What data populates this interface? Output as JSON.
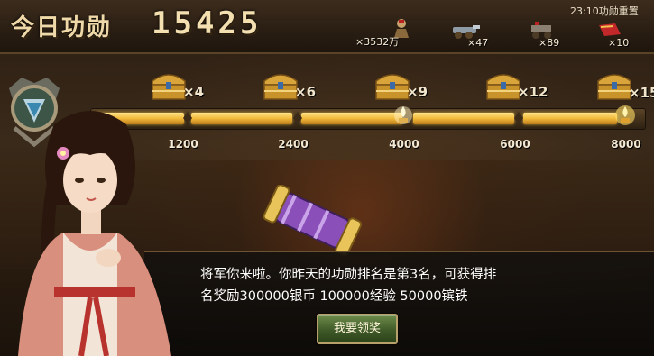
{
  "header": {
    "title": "今日功勋",
    "score": "15425",
    "reset_info": "23:10功勋重置"
  },
  "resources": [
    {
      "icon": "soldier-icon",
      "count": "×3532万"
    },
    {
      "icon": "cannon-icon",
      "count": "×47"
    },
    {
      "icon": "chariot-icon",
      "count": "×89"
    },
    {
      "icon": "red-gift-icon",
      "count": "×10"
    }
  ],
  "milestones": [
    {
      "chest_count": "×4",
      "value": "1200"
    },
    {
      "chest_count": "×6",
      "value": "2400"
    },
    {
      "chest_count": "×9",
      "value": "4000"
    },
    {
      "chest_count": "×12",
      "value": "6000"
    },
    {
      "chest_count": "×15",
      "value": "8000"
    }
  ],
  "progress": {
    "current": 15425,
    "max": 8000,
    "fraction": 1.0
  },
  "dialog": {
    "line1": "将军你来啦。你昨天的功勋排名是第3名，可获得排",
    "line2": "名奖励300000银币 100000经验 50000镔铁",
    "claim_button": "我要领奖"
  },
  "colors": {
    "gold": "#f2b93a",
    "text_light": "#f4ead4",
    "button_green": "#3f5a28"
  }
}
